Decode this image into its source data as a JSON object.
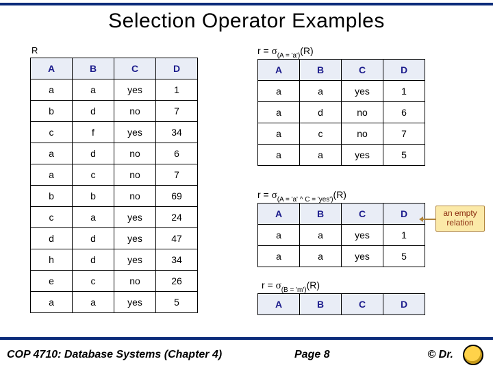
{
  "title": "Selection Operator Examples",
  "labelR": "R",
  "columns": [
    "A",
    "B",
    "C",
    "D"
  ],
  "relationR": [
    [
      "a",
      "a",
      "yes",
      "1"
    ],
    [
      "b",
      "d",
      "no",
      "7"
    ],
    [
      "c",
      "f",
      "yes",
      "34"
    ],
    [
      "a",
      "d",
      "no",
      "6"
    ],
    [
      "a",
      "c",
      "no",
      "7"
    ],
    [
      "b",
      "b",
      "no",
      "69"
    ],
    [
      "c",
      "a",
      "yes",
      "24"
    ],
    [
      "d",
      "d",
      "yes",
      "47"
    ],
    [
      "h",
      "d",
      "yes",
      "34"
    ],
    [
      "e",
      "c",
      "no",
      "26"
    ],
    [
      "a",
      "a",
      "yes",
      "5"
    ]
  ],
  "expr1": {
    "prefix": "r = ",
    "sub": "(A = 'a')",
    "suffix": "(R)"
  },
  "result1": [
    [
      "a",
      "a",
      "yes",
      "1"
    ],
    [
      "a",
      "d",
      "no",
      "6"
    ],
    [
      "a",
      "c",
      "no",
      "7"
    ],
    [
      "a",
      "a",
      "yes",
      "5"
    ]
  ],
  "expr2": {
    "prefix": "r = ",
    "sub": "(A = 'a' ^ C = 'yes')",
    "suffix": "(R)"
  },
  "result2": [
    [
      "a",
      "a",
      "yes",
      "1"
    ],
    [
      "a",
      "a",
      "yes",
      "5"
    ]
  ],
  "expr3": {
    "prefix": "r = ",
    "sub": "(B = 'm')",
    "suffix": "(R)"
  },
  "result3": [],
  "annotation": "an empty relation",
  "footer": {
    "course": "COP 4710: Database Systems  (Chapter 4)",
    "page": "Page 8",
    "author": "© Dr."
  },
  "chart_data": [
    {
      "type": "table",
      "title": "R",
      "columns": [
        "A",
        "B",
        "C",
        "D"
      ],
      "rows": [
        [
          "a",
          "a",
          "yes",
          1
        ],
        [
          "b",
          "d",
          "no",
          7
        ],
        [
          "c",
          "f",
          "yes",
          34
        ],
        [
          "a",
          "d",
          "no",
          6
        ],
        [
          "a",
          "c",
          "no",
          7
        ],
        [
          "b",
          "b",
          "no",
          69
        ],
        [
          "c",
          "a",
          "yes",
          24
        ],
        [
          "d",
          "d",
          "yes",
          47
        ],
        [
          "h",
          "d",
          "yes",
          34
        ],
        [
          "e",
          "c",
          "no",
          26
        ],
        [
          "a",
          "a",
          "yes",
          5
        ]
      ]
    },
    {
      "type": "table",
      "title": "σ(A='a')(R)",
      "columns": [
        "A",
        "B",
        "C",
        "D"
      ],
      "rows": [
        [
          "a",
          "a",
          "yes",
          1
        ],
        [
          "a",
          "d",
          "no",
          6
        ],
        [
          "a",
          "c",
          "no",
          7
        ],
        [
          "a",
          "a",
          "yes",
          5
        ]
      ]
    },
    {
      "type": "table",
      "title": "σ(A='a' ∧ C='yes')(R)",
      "columns": [
        "A",
        "B",
        "C",
        "D"
      ],
      "rows": [
        [
          "a",
          "a",
          "yes",
          1
        ],
        [
          "a",
          "a",
          "yes",
          5
        ]
      ]
    },
    {
      "type": "table",
      "title": "σ(B='m')(R)",
      "columns": [
        "A",
        "B",
        "C",
        "D"
      ],
      "rows": []
    }
  ]
}
